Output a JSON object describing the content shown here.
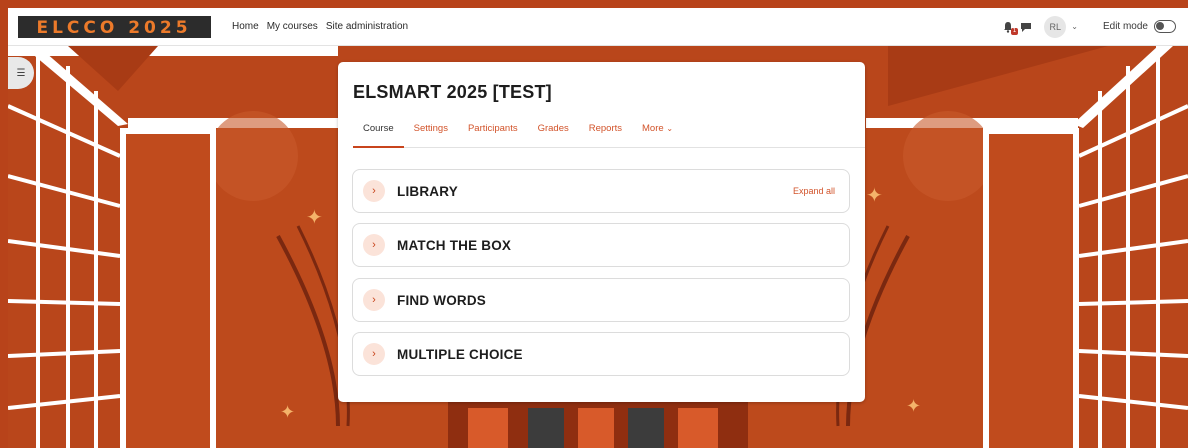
{
  "navbar": {
    "brand": "ELCCO 2025",
    "links": [
      "Home",
      "My courses",
      "Site administration"
    ],
    "notification_count": "1",
    "avatar_initials": "RL",
    "edit_mode_label": "Edit mode"
  },
  "course": {
    "title": "ELSMART 2025 [TEST]",
    "tabs": [
      "Course",
      "Settings",
      "Participants",
      "Grades",
      "Reports",
      "More"
    ],
    "expand_all": "Expand all",
    "sections": [
      "LIBRARY",
      "MATCH THE BOX",
      "FIND WORDS",
      "MULTIPLE CHOICE"
    ]
  },
  "colors": {
    "accent": "#c8441c",
    "link": "#d2532a",
    "background": "#b9461b"
  },
  "icons": {
    "drawer": "list-icon",
    "bell": "bell-icon",
    "chat": "chat-icon",
    "chevron": "chevron-right-icon"
  }
}
